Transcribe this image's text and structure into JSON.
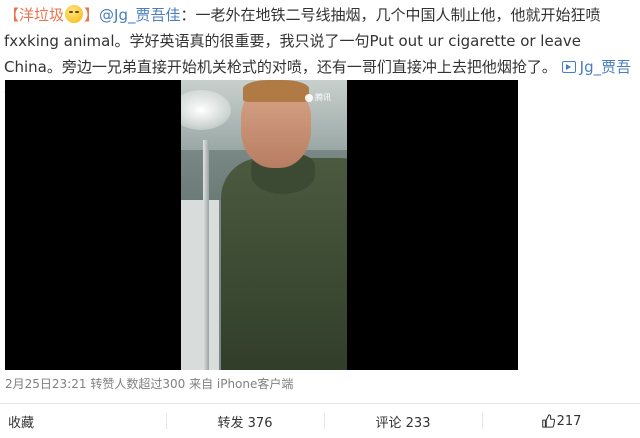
{
  "post": {
    "tag": "【洋垃圾",
    "tag_close": "】",
    "mention": "@Jg_贾吾佳",
    "body_line": "：一老外在地铁二号线抽烟，几个中国人制止他，他就开始狂喷 fxxking animal。学好英语真的很重要，我只说了一句Put out ur cigarette or leave China。旁边一兄弟直接开始机关枪式的对喷，还有一哥们直接冲上去把他烟抢了。",
    "link_text": "Jg_贾吾佳..."
  },
  "video": {
    "watermark": "腾讯"
  },
  "meta": {
    "time": "2月25日23:21",
    "reposts_note": "转赞人数超过300",
    "source": "来自 iPhone客户端"
  },
  "actions": {
    "favorite": "收藏",
    "repost": "转发 376",
    "comment": "评论 233",
    "like": "217"
  },
  "colors": {
    "accent": "#eb7350",
    "link": "#4a7dbf",
    "meta": "#808080"
  }
}
